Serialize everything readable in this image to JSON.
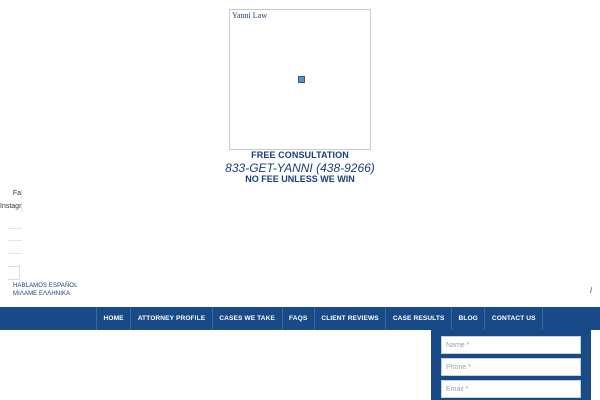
{
  "logo": {
    "alt_text": "Yanni Law"
  },
  "cta": {
    "line1": "FREE CONSULTATION",
    "phone": "833-GET-YANNI (438-9266)",
    "line3": "NO FEE UNLESS WE WIN"
  },
  "social": {
    "facebook": "Fa",
    "instagram": "Instagram"
  },
  "languages": {
    "spanish": "HABLAMOS ESPAÑOL",
    "greek": "ΜΙΛΑΜΕ ΕΛΛΗΝΙΚΑ"
  },
  "misc": {
    "slash": "/"
  },
  "nav": {
    "items": [
      "HOME",
      "ATTORNEY PROFILE",
      "CASES WE TAKE",
      "FAQS",
      "CLIENT REVIEWS",
      "CASE RESULTS",
      "BLOG",
      "CONTACT US"
    ]
  },
  "form": {
    "name_placeholder": "Name *",
    "phone_placeholder": "Phone *",
    "email_placeholder": "Email *"
  },
  "colors": {
    "brand_blue": "#174a87",
    "text_blue": "#173f7a"
  }
}
